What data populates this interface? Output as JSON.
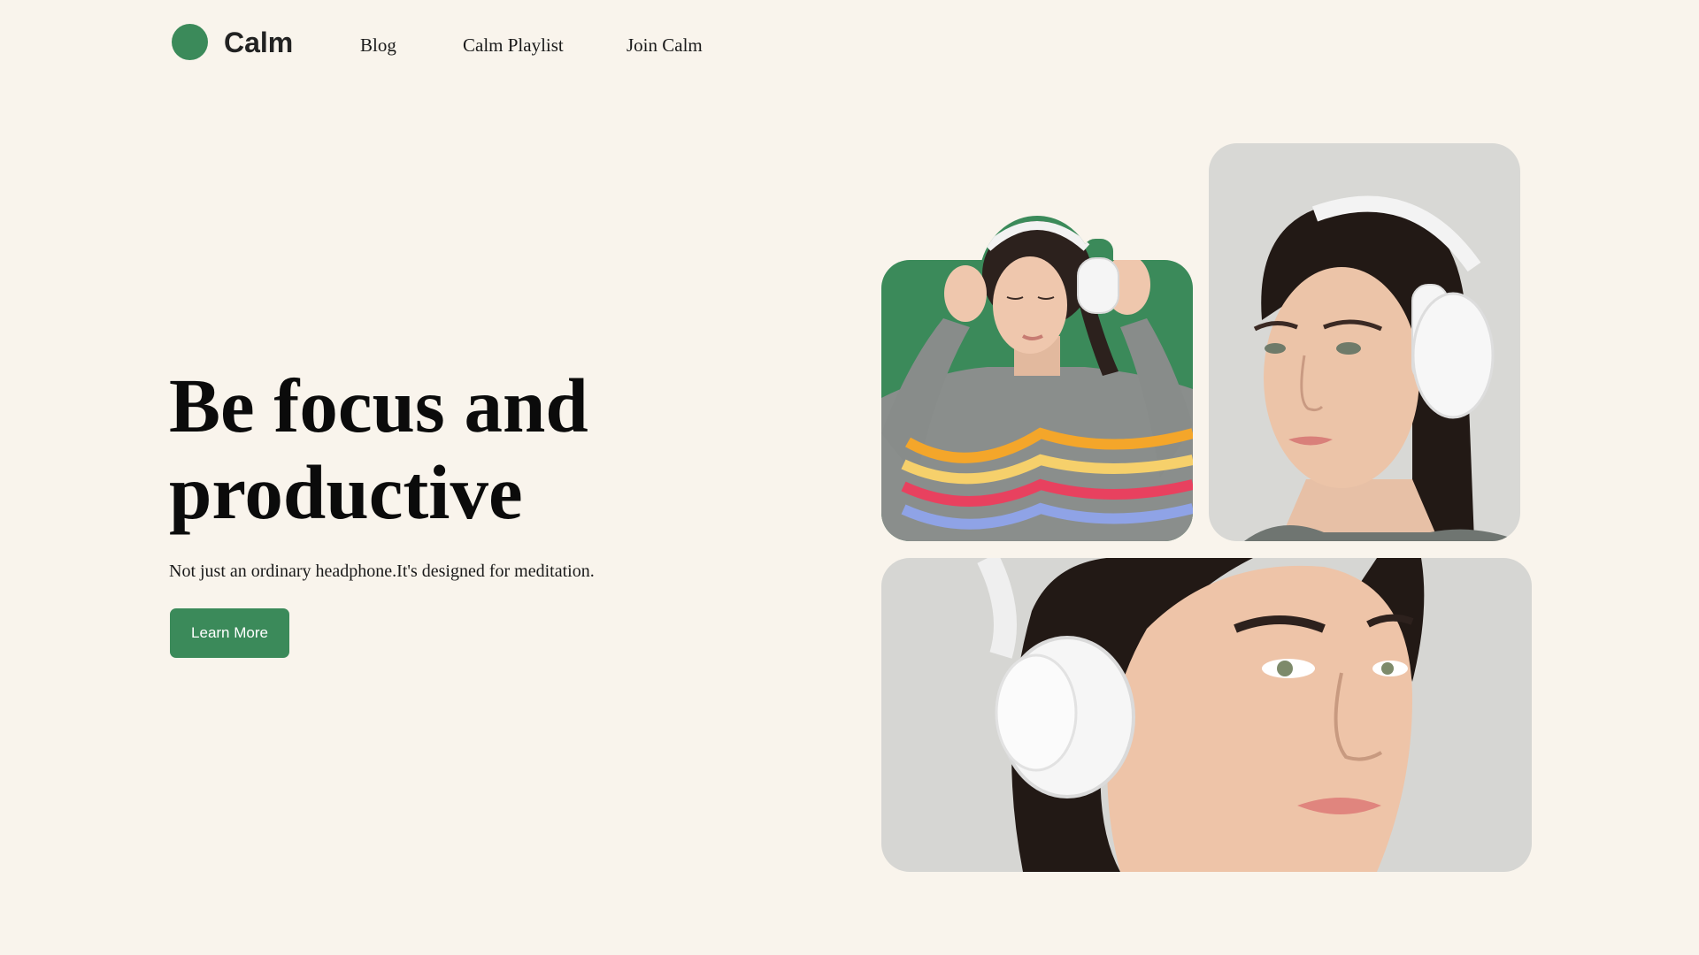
{
  "brand": {
    "name": "Calm",
    "color": "#3b8a5a"
  },
  "nav": {
    "items": [
      {
        "label": "Blog"
      },
      {
        "label": "Calm Playlist"
      },
      {
        "label": "Join Calm"
      }
    ]
  },
  "hero": {
    "title_line1": "Be focus and",
    "title_line2": "productive",
    "subtitle": "Not just an ordinary headphone.It's designed for meditation.",
    "cta_label": "Learn More"
  },
  "photos": [
    {
      "subject": "woman-with-headphones-green-background",
      "background": "#3b8a5a"
    },
    {
      "subject": "woman-with-headphones-profile",
      "background": "#d8d8d5"
    },
    {
      "subject": "woman-with-headphones-closeup",
      "background": "#d6d6d3"
    }
  ],
  "colors": {
    "page_background": "#f9f4ec",
    "accent": "#3b8a5a",
    "text": "#111111"
  }
}
